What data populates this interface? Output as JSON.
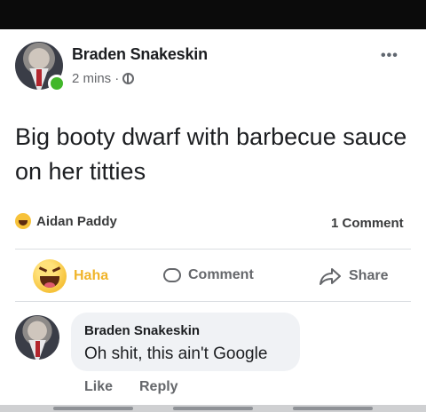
{
  "post": {
    "author": "Braden Snakeskin",
    "time": "2 mins",
    "separator": "·",
    "more_label": "•••",
    "text": "Big booty dwarf with barbecue sauce on her titties"
  },
  "reactions": {
    "reactor": "Aidan Paddy",
    "comment_count": "1 Comment"
  },
  "actions": {
    "haha_label": "Haha",
    "comment_label": "Comment",
    "share_label": "Share"
  },
  "comment": {
    "author": "Braden Snakeskin",
    "text": "Oh shit, this ain't Google",
    "like_label": "Like",
    "reply_label": "Reply"
  },
  "icons": {
    "privacy": "globe-icon",
    "reaction": "haha-icon",
    "comment": "comment-icon",
    "share": "share-icon"
  },
  "colors": {
    "haha_accent": "#f0b429",
    "online_status": "#42b72a",
    "secondary_text": "#65676b",
    "bubble_bg": "#f0f2f5"
  }
}
